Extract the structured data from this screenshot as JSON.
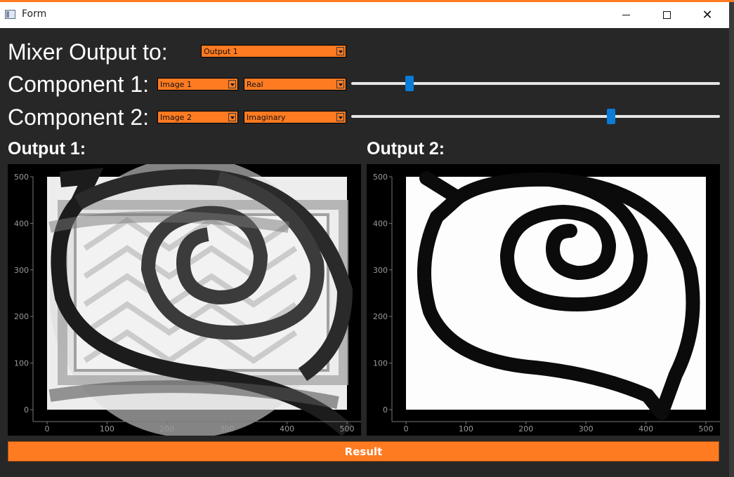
{
  "window": {
    "title": "Form"
  },
  "colors": {
    "accent": "#ff7b22",
    "slider_handle": "#0a7bd6",
    "background": "#272727"
  },
  "mixer": {
    "label": "Mixer Output to:",
    "selected": "Output 1"
  },
  "component1": {
    "label": "Component 1:",
    "image": "Image 1",
    "mode": "Real",
    "ratio": 0.15
  },
  "component2": {
    "label": "Component 2:",
    "image": "Image 2",
    "mode": "Imaginary",
    "ratio": 0.71
  },
  "outputs": [
    {
      "label": "Output 1:",
      "x_ticks": [
        "0",
        "100",
        "200",
        "300",
        "400",
        "500"
      ],
      "y_ticks": [
        "0",
        "100",
        "200",
        "300",
        "400",
        "500"
      ]
    },
    {
      "label": "Output 2:",
      "x_ticks": [
        "0",
        "100",
        "200",
        "300",
        "400",
        "500"
      ],
      "y_ticks": [
        "0",
        "100",
        "200",
        "300",
        "400",
        "500"
      ]
    }
  ],
  "result_button": "Result"
}
